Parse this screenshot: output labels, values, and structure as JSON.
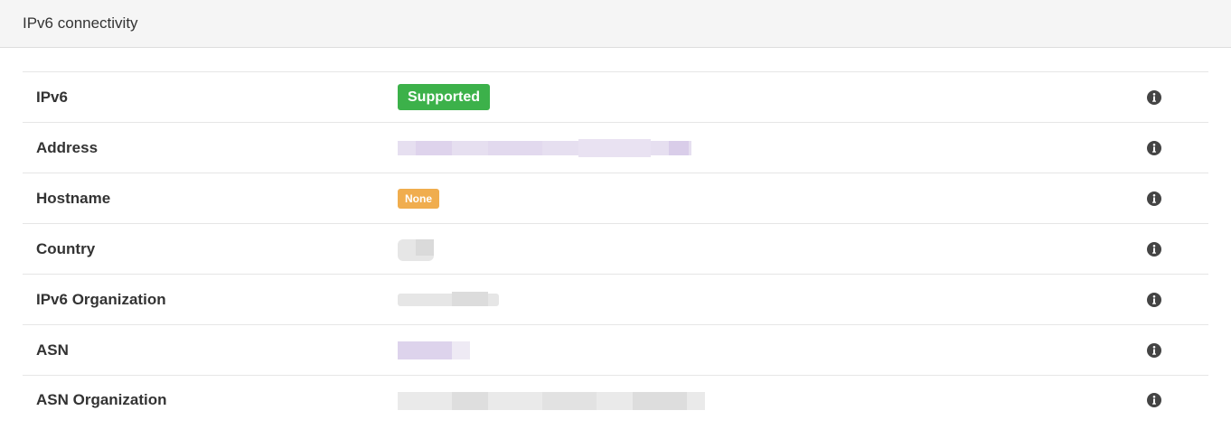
{
  "panel": {
    "title": "IPv6 connectivity"
  },
  "rows": [
    {
      "label": "IPv6",
      "badge": "Supported"
    },
    {
      "label": "Address"
    },
    {
      "label": "Hostname",
      "badge": "None"
    },
    {
      "label": "Country"
    },
    {
      "label": "IPv6 Organization"
    },
    {
      "label": "ASN"
    },
    {
      "label": "ASN Organization"
    }
  ],
  "icons": {
    "row_action": "info-circle-icon"
  },
  "colors": {
    "supported_badge": "#3cb14a",
    "none_badge": "#f0ad4e",
    "redaction_purple": "#e0d8ee",
    "redaction_gray": "#e2e2e2"
  }
}
